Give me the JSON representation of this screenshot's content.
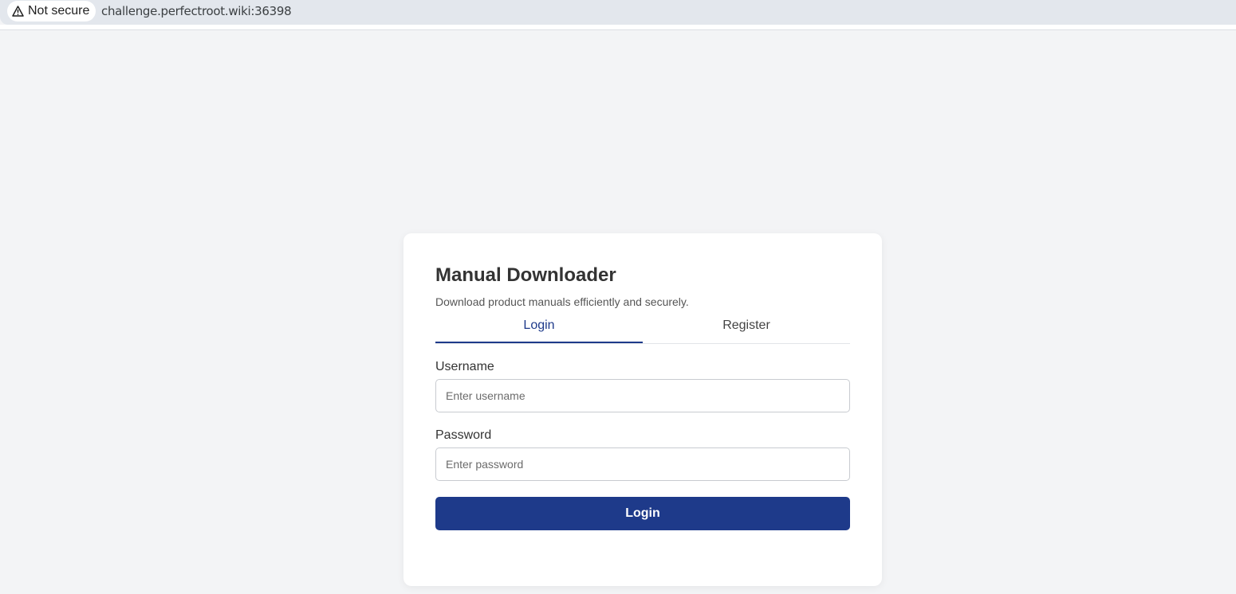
{
  "browser": {
    "security_label": "Not secure",
    "url": "challenge.perfectroot.wiki:36398"
  },
  "card": {
    "title": "Manual Downloader",
    "subtitle": "Download product manuals efficiently and securely.",
    "tabs": [
      {
        "label": "Login",
        "active": true
      },
      {
        "label": "Register",
        "active": false
      }
    ],
    "form": {
      "username_label": "Username",
      "username_placeholder": "Enter username",
      "username_value": "",
      "password_label": "Password",
      "password_placeholder": "Enter password",
      "password_value": "",
      "submit_label": "Login"
    }
  },
  "icons": {
    "security": "warning-triangle-icon"
  },
  "colors": {
    "primary": "#1e3a8a",
    "page_background": "#f3f4f6",
    "card_background": "#ffffff",
    "address_bar": "#e3e7ed"
  }
}
